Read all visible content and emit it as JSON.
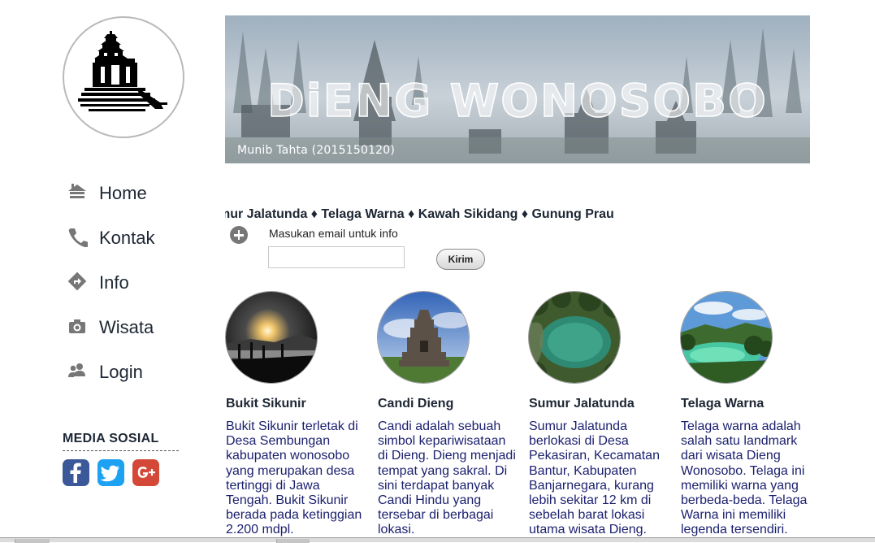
{
  "sidebar": {
    "logo_icon": "temple-logo",
    "nav": [
      {
        "label": "Home",
        "icon": "home-icon"
      },
      {
        "label": "Kontak",
        "icon": "phone-icon"
      },
      {
        "label": "Info",
        "icon": "info-direction-icon"
      },
      {
        "label": "Wisata",
        "icon": "camera-icon"
      },
      {
        "label": "Login",
        "icon": "users-icon"
      }
    ],
    "social_title": "MEDIA SOSIAL",
    "social": [
      {
        "name": "facebook-icon",
        "color": "#3b5998"
      },
      {
        "name": "twitter-icon",
        "color": "#1da1f2"
      },
      {
        "name": "google-plus-icon",
        "color": "#d34836"
      }
    ]
  },
  "banner": {
    "title": "DiENG WONOSOBO",
    "subtitle": "Munib Tahta (2015150120)"
  },
  "marquee": {
    "text": "mur Jalatunda ♦ Telaga Warna ♦ Kawah Sikidang ♦ Gunung Prau"
  },
  "subscribe": {
    "label": "Masukan email untuk info",
    "value": "",
    "button": "Kirim"
  },
  "cards": [
    {
      "title": "Bukit Sikunir",
      "desc": "Bukit Sikunir terletak di Desa Sembungan kabupaten wonosobo yang merupakan desa tertinggi di Jawa Tengah. Bukit Sikunir berada pada ketinggian 2.200 mdpl."
    },
    {
      "title": "Candi Dieng",
      "desc": "Candi adalah sebuah simbol kepariwisataan di Dieng. Dieng menjadi tempat yang sakral. Di sini terdapat banyak Candi Hindu yang tersebar di berbagai lokasi."
    },
    {
      "title": "Sumur Jalatunda",
      "desc": "Sumur Jalatunda berlokasi di Desa Pekasiran, Kecamatan Bantur, Kabupaten Banjarnegara, kurang lebih sekitar 12 km di sebelah barat lokasi utama wisata Dieng."
    },
    {
      "title": "Telaga Warna",
      "desc": "Telaga warna adalah salah satu landmark dari wisata Dieng Wonosobo. Telaga ini memiliki warna yang berbeda-beda. Telaga Warna ini memiliki legenda tersendiri."
    }
  ]
}
